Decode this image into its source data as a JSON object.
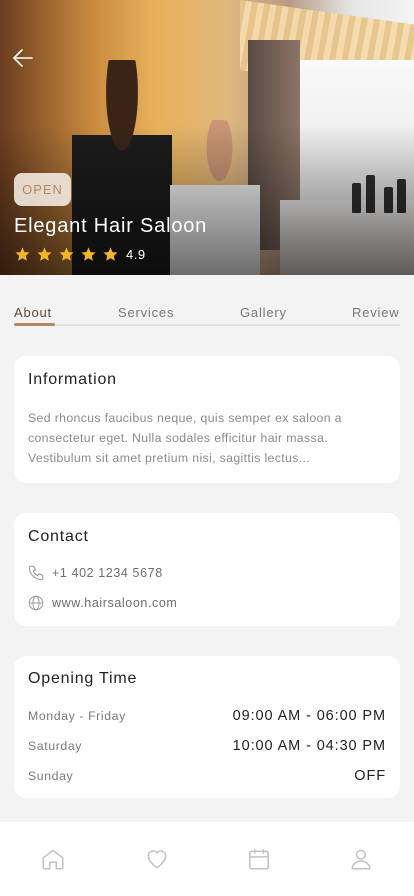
{
  "hero": {
    "status_badge": "OPEN",
    "title": "Elegant Hair Saloon",
    "rating": "4.9",
    "star_count": 5,
    "star_color": "#F5B623"
  },
  "tabs": [
    {
      "label": "About",
      "active": true
    },
    {
      "label": "Services",
      "active": false
    },
    {
      "label": "Gallery",
      "active": false
    },
    {
      "label": "Review",
      "active": false
    }
  ],
  "information": {
    "title": "Information",
    "text": "Sed rhoncus faucibus neque, quis semper ex saloon a consectetur eget. Nulla sodales efficitur hair massa. Vestibulum sit amet pretium nisi, sagittis lectus..."
  },
  "contact": {
    "title": "Contact",
    "phone": "+1 402 1234 5678",
    "website": "www.hairsaloon.com"
  },
  "opening_time": {
    "title": "Opening Time",
    "rows": [
      {
        "day": "Monday - Friday",
        "time": "09:00 AM - 06:00 PM"
      },
      {
        "day": "Saturday",
        "time": "10:00 AM - 04:30 PM"
      },
      {
        "day": "Sunday",
        "time": "OFF"
      }
    ]
  },
  "nav": {
    "items": [
      "home-icon",
      "heart-icon",
      "calendar-icon",
      "user-icon"
    ]
  },
  "colors": {
    "accent": "#B38A63",
    "background": "#F3F3F3"
  }
}
